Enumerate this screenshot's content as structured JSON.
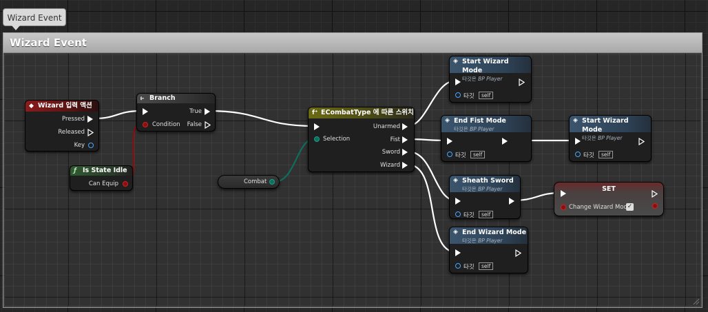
{
  "tab": {
    "label": "Wizard Event"
  },
  "comment": {
    "title": "Wizard Event"
  },
  "colors": {
    "event_header": "#8a1c1c",
    "pure_header": "#315a31",
    "branch_header": "#3e3e3e",
    "switch_header": "#6b6b14",
    "function_header": "#3b556d",
    "set_header": "#6a2a2a",
    "exec_wire": "#ffffff",
    "bool_wire": "#8c0f0f",
    "enum_wire": "#0f6e5e",
    "object_pin": "#4aa8ff"
  },
  "nodes": {
    "input_action": {
      "title": "Wizard 입력 액션",
      "icon": "event-diamond-icon",
      "pins": {
        "pressed": "Pressed",
        "released": "Released",
        "key": "Key"
      }
    },
    "is_state_idle": {
      "title": "Is State Idle",
      "icon": "function-f-icon",
      "pins": {
        "can_equip": "Can Equip"
      }
    },
    "branch": {
      "title": "Branch",
      "icon": "branch-icon",
      "pins": {
        "condition": "Condition",
        "true": "True",
        "false": "False"
      }
    },
    "combat_var": {
      "label": "Combat"
    },
    "switch": {
      "title": "ECombatType 에 따른 스위치",
      "icon": "switch-icon",
      "pins": {
        "selection": "Selection",
        "unarmed": "Unarmed",
        "fist": "Fist",
        "sword": "Sword",
        "wizard": "Wizard"
      }
    },
    "start_wizard_1": {
      "title": "Start Wizard Mode",
      "subtitle_prefix": "타깃은",
      "subtitle_target": "BP Player",
      "target_label": "타깃",
      "self_label": "self"
    },
    "end_fist": {
      "title": "End Fist Mode",
      "subtitle_prefix": "타깃은",
      "subtitle_target": "BP Player",
      "target_label": "타깃",
      "self_label": "self"
    },
    "start_wizard_2": {
      "title": "Start Wizard Mode",
      "subtitle_prefix": "타깃은",
      "subtitle_target": "BP Player",
      "target_label": "타깃",
      "self_label": "self"
    },
    "sheath_sword": {
      "title": "Sheath Sword",
      "subtitle_prefix": "타깃은",
      "subtitle_target": "BP Player",
      "target_label": "타깃",
      "self_label": "self"
    },
    "end_wizard": {
      "title": "End Wizard Mode",
      "subtitle_prefix": "타깃은",
      "subtitle_target": "BP Player",
      "target_label": "타깃",
      "self_label": "self"
    },
    "set": {
      "title": "SET",
      "pins": {
        "change_wizard_mode": "Change Wizard Mode"
      },
      "checked": true
    }
  }
}
